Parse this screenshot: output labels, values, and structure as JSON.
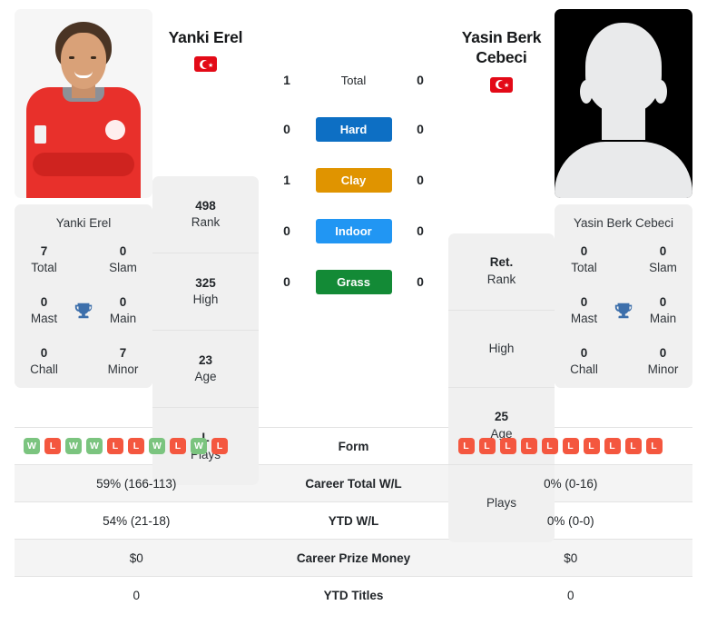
{
  "players": {
    "left": {
      "name": "Yanki Erel",
      "flag": "turkey-flag",
      "card_name": "Yanki Erel",
      "titles": {
        "total_value": "7",
        "total_label": "Total",
        "slam_value": "0",
        "slam_label": "Slam",
        "mast_value": "0",
        "mast_label": "Mast",
        "main_value": "0",
        "main_label": "Main",
        "chall_value": "0",
        "chall_label": "Chall",
        "minor_value": "7",
        "minor_label": "Minor"
      },
      "profile": [
        {
          "value": "498",
          "label": "Rank"
        },
        {
          "value": "325",
          "label": "High"
        },
        {
          "value": "23",
          "label": "Age"
        },
        {
          "value": "L",
          "label": "Plays"
        }
      ],
      "form": [
        "W",
        "L",
        "W",
        "W",
        "L",
        "L",
        "W",
        "L",
        "W",
        "L"
      ],
      "career_total_wl": "59% (166-113)",
      "ytd_wl": "54% (21-18)",
      "career_prize_money": "$0",
      "ytd_titles": "0"
    },
    "right": {
      "name": "Yasin Berk Cebeci",
      "flag": "turkey-flag",
      "card_name": "Yasin Berk Cebeci",
      "titles": {
        "total_value": "0",
        "total_label": "Total",
        "slam_value": "0",
        "slam_label": "Slam",
        "mast_value": "0",
        "mast_label": "Mast",
        "main_value": "0",
        "main_label": "Main",
        "chall_value": "0",
        "chall_label": "Chall",
        "minor_value": "0",
        "minor_label": "Minor"
      },
      "profile": [
        {
          "value": "Ret.",
          "label": "Rank"
        },
        {
          "value": "",
          "label": "High"
        },
        {
          "value": "25",
          "label": "Age"
        },
        {
          "value": "",
          "label": "Plays"
        }
      ],
      "form": [
        "L",
        "L",
        "L",
        "L",
        "L",
        "L",
        "L",
        "L",
        "L",
        "L"
      ],
      "career_total_wl": "0% (0-16)",
      "ytd_wl": "0% (0-0)",
      "career_prize_money": "$0",
      "ytd_titles": "0"
    }
  },
  "surfaces": [
    {
      "key": "total",
      "label": "Total",
      "left": "1",
      "right": "0",
      "badge": false,
      "color": ""
    },
    {
      "key": "hard",
      "label": "Hard",
      "left": "0",
      "right": "0",
      "badge": true,
      "color": "#0d6fc4"
    },
    {
      "key": "clay",
      "label": "Clay",
      "left": "1",
      "right": "0",
      "badge": true,
      "color": "#e09400"
    },
    {
      "key": "indoor",
      "label": "Indoor",
      "left": "0",
      "right": "0",
      "badge": true,
      "color": "#2196f3"
    },
    {
      "key": "grass",
      "label": "Grass",
      "left": "0",
      "right": "0",
      "badge": true,
      "color": "#138a36"
    }
  ],
  "table": {
    "form_label": "Form",
    "career_total_wl_label": "Career Total W/L",
    "ytd_wl_label": "YTD W/L",
    "career_prize_money_label": "Career Prize Money",
    "ytd_titles_label": "YTD Titles"
  },
  "icons": {
    "trophy": "trophy-icon"
  }
}
